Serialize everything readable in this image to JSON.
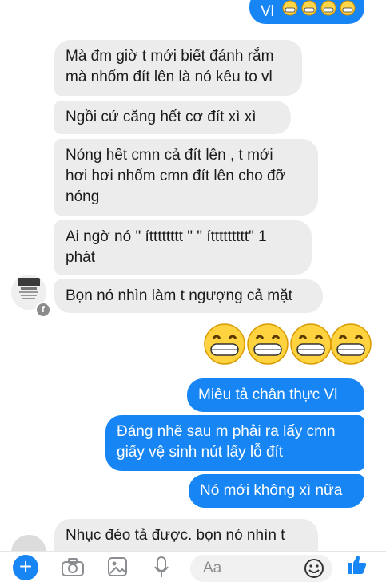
{
  "messages": {
    "top_partial": "Vl",
    "incoming": [
      "Mà đm giờ t mới biết đánh rắm",
      "mà nhổm đít lên là nó kêu to vl",
      "Ngồi cứ căng hết cơ đít xì xì",
      "Nóng hết cmn cả đít lên , t mới",
      "hơi hơi nhổm cmn đít lên cho đỡ",
      "nóng",
      "Ai ngờ nó \" ítttttttt \" \" íttttttttt\" 1",
      "phát",
      "Bọn nó nhìn làm t ngượng cả mặt"
    ],
    "outgoing": [
      "Miêu tả chân thực Vl",
      "Đáng nhẽ sau m phải ra lấy cmn",
      "giấy vệ sinh nút lấy lỗ đít",
      "Nó mới không xì nữa"
    ],
    "bottom_partial": "Nhục đéo tả được. bọn nó nhìn t"
  },
  "composer": {
    "placeholder": "Aa"
  },
  "icons": [
    "plus-icon",
    "camera-icon",
    "gallery-icon",
    "mic-icon",
    "emoji-icon",
    "thumbs-up-icon",
    "facebook-badge-icon",
    "grinning-emoji-icon"
  ],
  "colors": {
    "outgoing": "#1786f4",
    "incoming": "#ececec"
  }
}
